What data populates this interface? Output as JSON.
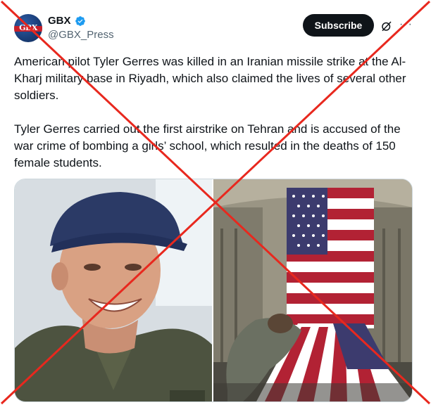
{
  "account": {
    "display_name": "GBX",
    "handle": "@GBX_Press",
    "avatar_text": "GBX",
    "verified_icon": "verified-badge-icon"
  },
  "actions": {
    "subscribe_label": "Subscribe",
    "grok_icon": "grok-icon",
    "more_icon": "more-options-icon"
  },
  "post": {
    "paragraph_1": "American pilot Tyler Gerres was killed in an Iranian missile strike at the Al-Kharj military base in Riyadh, which also claimed the lives of several other soldiers.",
    "paragraph_2": "Tyler Gerres carried out the first airstrike on Tehran and is accused of the war crime of bombing a girls’ school, which resulted in the deaths of 150 female students."
  },
  "media": {
    "left_photo": "smiling-pilot-photo",
    "right_photo": "flag-draped-coffin-photo"
  },
  "colors": {
    "accent_verified": "#1d9bf0",
    "subscribe_bg": "#0f1419",
    "overlay_x": "#e8281e",
    "secondary_text": "#536471"
  }
}
